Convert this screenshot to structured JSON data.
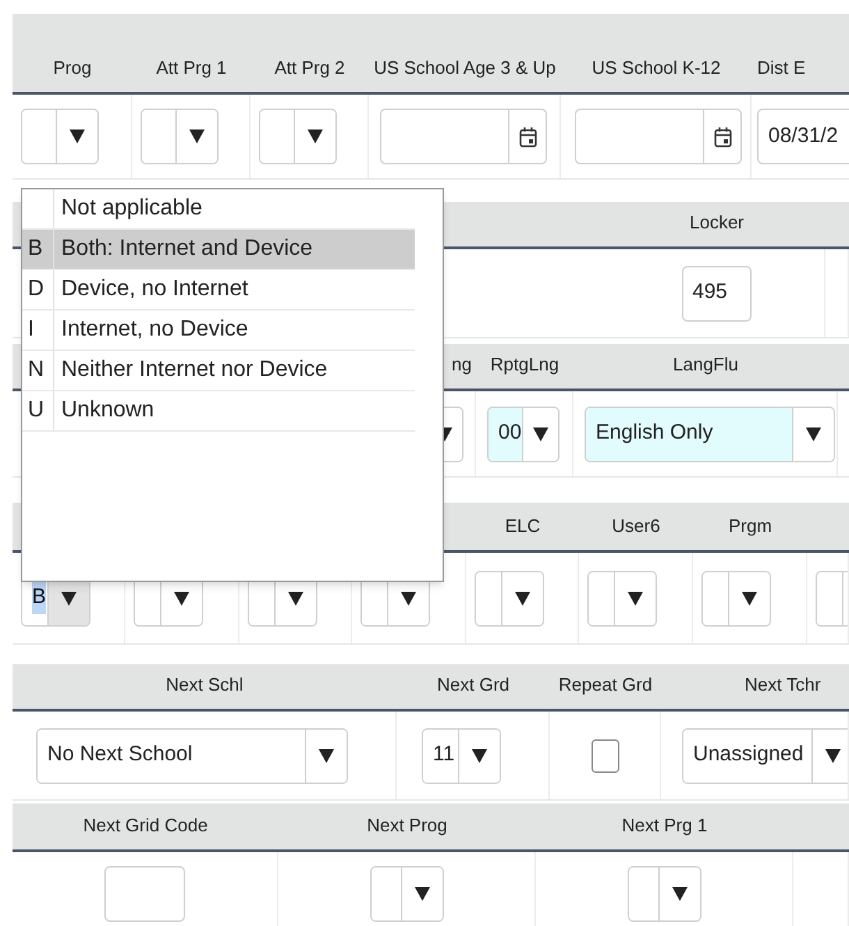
{
  "sections": [
    {
      "columns": [
        {
          "label": "Prog",
          "field": {
            "kind": "select"
          }
        },
        {
          "label": "Att Prg 1",
          "field": {
            "kind": "select"
          }
        },
        {
          "label": "Att Prg 2",
          "field": {
            "kind": "select"
          }
        },
        {
          "label": "US School Age 3 & Up",
          "field": {
            "kind": "date"
          }
        },
        {
          "label": "US School K-12",
          "field": {
            "kind": "date"
          }
        },
        {
          "label": "Dist E",
          "field": {
            "kind": "text",
            "value": "08/31/2"
          }
        }
      ]
    },
    {
      "columns": [
        {
          "label": "Locker",
          "field": {
            "kind": "text",
            "value": "495"
          }
        },
        {}
      ]
    },
    {
      "columns": [
        {
          "label": "ng",
          "field": {
            "kind": "select"
          }
        },
        {
          "label": "RptgLng",
          "field": {
            "kind": "select",
            "value": "00",
            "tinted": true
          }
        },
        {
          "label": "LangFlu",
          "field": {
            "kind": "select",
            "value": "English Only",
            "tinted": true
          }
        }
      ]
    },
    {
      "columns": [
        {
          "field": {
            "kind": "select",
            "value": "B",
            "focused": true
          }
        },
        {
          "field": {
            "kind": "select"
          }
        },
        {
          "field": {
            "kind": "select"
          }
        },
        {
          "field": {
            "kind": "select"
          }
        },
        {
          "label": "ELC",
          "field": {
            "kind": "select"
          }
        },
        {
          "label": "User6",
          "field": {
            "kind": "select"
          }
        },
        {
          "label": "Prgm",
          "field": {
            "kind": "select"
          }
        },
        {
          "field": {
            "kind": "select"
          }
        }
      ]
    },
    {
      "columns": [
        {
          "label": "Next Schl",
          "field": {
            "kind": "select",
            "value": "No Next School"
          }
        },
        {
          "label": "Next Grd",
          "field": {
            "kind": "select",
            "value": "11"
          }
        },
        {
          "label": "Repeat Grd",
          "field": {
            "kind": "checkbox",
            "checked": false
          }
        },
        {
          "label": "Next Tchr",
          "field": {
            "kind": "select",
            "value": "Unassigned"
          }
        }
      ]
    },
    {
      "columns": [
        {
          "label": "Next Grid Code",
          "field": {
            "kind": "text"
          }
        },
        {
          "label": "Next Prog",
          "field": {
            "kind": "select"
          }
        },
        {
          "label": "Next Prg 1",
          "field": {
            "kind": "select"
          }
        },
        {}
      ]
    }
  ],
  "dropdown": {
    "items": [
      {
        "label": "Not applicable",
        "selected": false
      },
      {
        "code": "B",
        "label": "Both: Internet and Device",
        "selected": true
      },
      {
        "code": "D",
        "label": "Device, no Internet",
        "selected": false
      },
      {
        "code": "I",
        "label": "Internet, no Device",
        "selected": false
      },
      {
        "code": "N",
        "label": "Neither Internet nor Device",
        "selected": false
      },
      {
        "code": "U",
        "label": "Unknown",
        "selected": false
      }
    ]
  }
}
